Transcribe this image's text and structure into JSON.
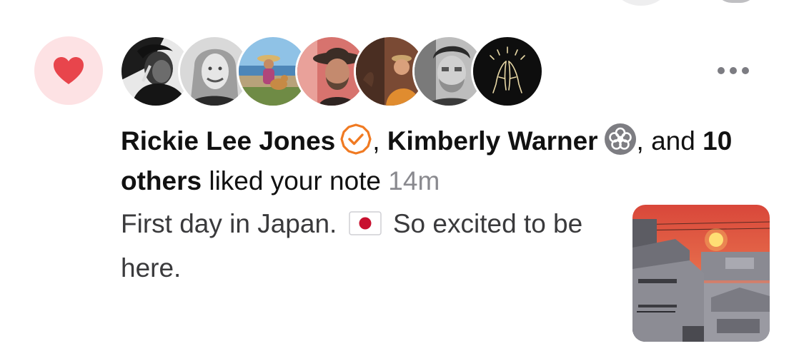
{
  "notification": {
    "type_icon": "heart-icon",
    "accent_color": "#e8454c",
    "badge_bg": "#fde2e4",
    "avatars": [
      {
        "name": "avatar-1",
        "icon": "portrait-bw"
      },
      {
        "name": "avatar-2",
        "icon": "portrait-bw"
      },
      {
        "name": "avatar-3",
        "icon": "portrait-beach-dog"
      },
      {
        "name": "avatar-4",
        "icon": "portrait-hat"
      },
      {
        "name": "avatar-5",
        "icon": "portrait-orange"
      },
      {
        "name": "avatar-6",
        "icon": "portrait-bw"
      },
      {
        "name": "avatar-7",
        "icon": "praying-hands-icon"
      }
    ],
    "more_icon": "ellipsis-icon",
    "user1": "Rickie Lee Jones",
    "sep1": ", ",
    "user2": "Kimberly Warner",
    "sep2": ", and",
    "others": "10 others",
    "action": " liked your note ",
    "time": "14m",
    "note_text_part1": "First day in Japan. ",
    "note_text_part2": " So excited to be here.",
    "flag_icon": "japan-flag-icon",
    "thumbnail_icon": "sunset-photo"
  }
}
